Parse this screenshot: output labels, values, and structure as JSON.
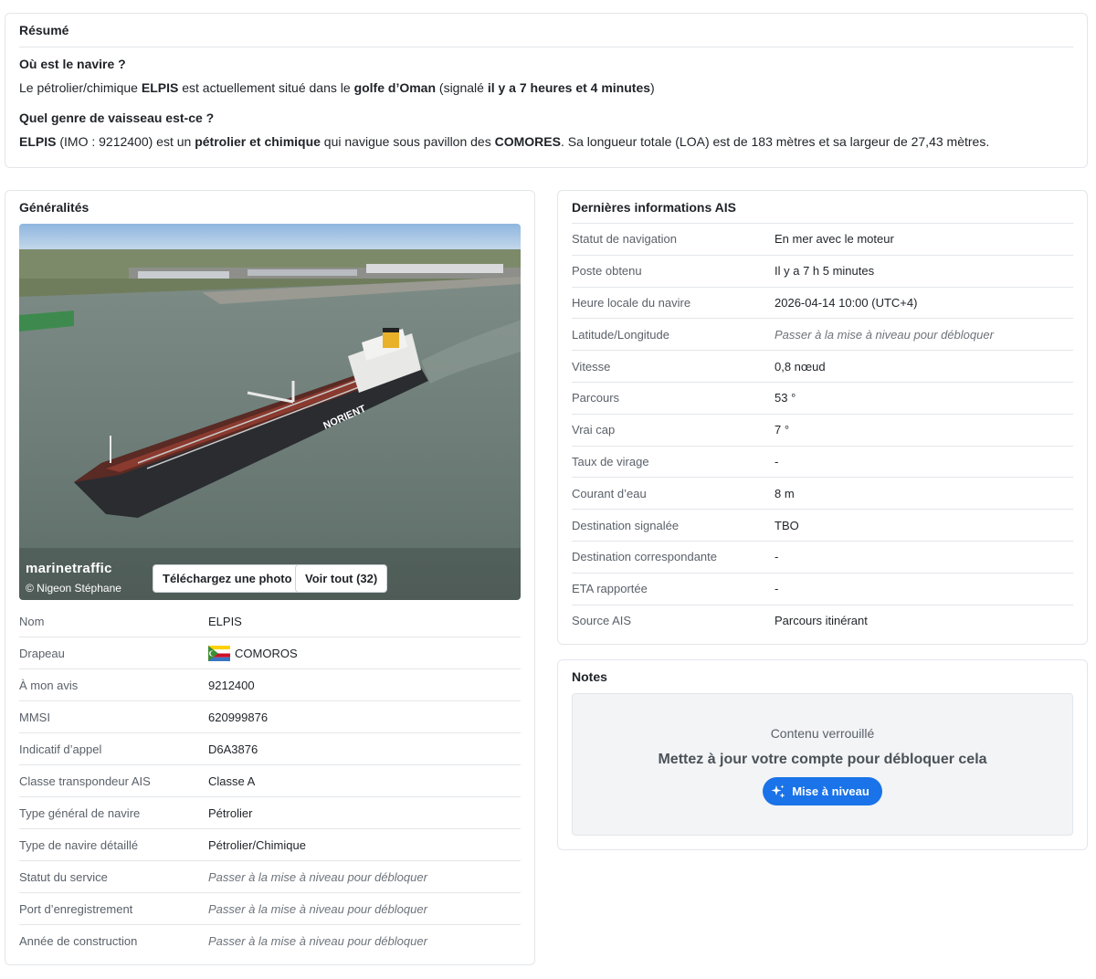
{
  "summary": {
    "title": "Résumé",
    "q1": "Où est le navire ?",
    "a1": {
      "t1": "Le pétrolier/chimique ",
      "name": "ELPIS",
      "t2": " est actuellement situé dans le ",
      "place": "golfe d’Oman",
      "t3": " (signalé ",
      "time": "il y a 7 heures et 4 minutes",
      "t4": ")"
    },
    "q2": "Quel genre de vaisseau est-ce ?",
    "a2": {
      "name": "ELPIS",
      "t1": " (IMO : 9212400) est un ",
      "type": "pétrolier et chimique",
      "t2": " qui navigue sous pavillon des ",
      "flag": "COMORES",
      "t3": ". Sa longueur totale (LOA) est de 183 mètres et sa largeur de 27,43 mètres."
    }
  },
  "general": {
    "title": "Généralités",
    "photo": {
      "watermark": "marinetraffic",
      "credit": "© Nigeon Stéphane",
      "upload_label": "Téléchargez une photo",
      "view_all_label": "Voir tout (32)",
      "hull_text": "NORIENT"
    },
    "rows": [
      {
        "k": "Nom",
        "v": "ELPIS"
      },
      {
        "k": "Drapeau",
        "v": "COMOROS"
      },
      {
        "k": "À mon avis",
        "v": "9212400"
      },
      {
        "k": "MMSI",
        "v": "620999876"
      },
      {
        "k": "Indicatif d’appel",
        "v": "D6A3876"
      },
      {
        "k": "Classe transpondeur AIS",
        "v": "Classe A"
      },
      {
        "k": "Type général de navire",
        "v": "Pétrolier"
      },
      {
        "k": "Type de navire détaillé",
        "v": "Pétrolier/Chimique"
      },
      {
        "k": "Statut du service",
        "v": "Passer à la mise à niveau pour débloquer"
      },
      {
        "k": "Port d’enregistrement",
        "v": "Passer à la mise à niveau pour débloquer"
      },
      {
        "k": "Année de construction",
        "v": "Passer à la mise à niveau pour débloquer"
      }
    ]
  },
  "ais": {
    "title": "Dernières informations AIS",
    "rows": [
      {
        "k": "Statut de navigation",
        "v": "En mer avec le moteur"
      },
      {
        "k": "Poste obtenu",
        "v": "Il y a 7 h 5 minutes"
      },
      {
        "k": "Heure locale du navire",
        "v": "2026-04-14 10:00 (UTC+4)"
      },
      {
        "k": "Latitude/Longitude",
        "v": "Passer à la mise à niveau pour débloquer"
      },
      {
        "k": "Vitesse",
        "v": "0,8 nœud"
      },
      {
        "k": "Parcours",
        "v": "53 °"
      },
      {
        "k": "Vrai cap",
        "v": "7 °"
      },
      {
        "k": "Taux de virage",
        "v": "-"
      },
      {
        "k": "Courant d’eau",
        "v": "8 m"
      },
      {
        "k": "Destination signalée",
        "v": "TBO"
      },
      {
        "k": "Destination correspondante",
        "v": "-"
      },
      {
        "k": "ETA rapportée",
        "v": "-"
      },
      {
        "k": "Source AIS",
        "v": "Parcours itinérant"
      }
    ]
  },
  "notes": {
    "title": "Notes",
    "locked_label": "Contenu verrouillé",
    "locked_message": "Mettez à jour votre compte pour débloquer cela",
    "upgrade_label": "Mise à niveau"
  },
  "colors": {
    "accent": "#1a73e8",
    "border": "#e3e6ea",
    "locked_bg": "#f3f4f6"
  }
}
